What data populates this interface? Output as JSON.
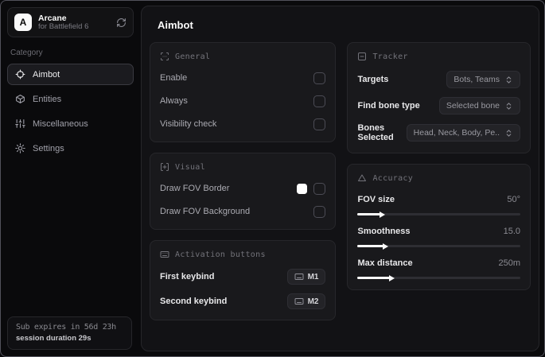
{
  "sidebar": {
    "logo_letter": "A",
    "app_name": "Arcane",
    "app_subtitle": "for Battlefield 6",
    "category_label": "Category",
    "items": [
      {
        "label": "Aimbot",
        "icon": "crosshair-icon",
        "active": true
      },
      {
        "label": "Entities",
        "icon": "cube-icon",
        "active": false
      },
      {
        "label": "Miscellaneous",
        "icon": "sliders-icon",
        "active": false
      },
      {
        "label": "Settings",
        "icon": "gear-icon",
        "active": false
      }
    ],
    "subscription": {
      "expires": "Sub expires in 56d 23h",
      "session": "session duration 29s"
    }
  },
  "main": {
    "title": "Aimbot",
    "general": {
      "title": "General",
      "rows": [
        {
          "label": "Enable",
          "checked": false
        },
        {
          "label": "Always",
          "checked": false
        },
        {
          "label": "Visibility check",
          "checked": false
        }
      ]
    },
    "visual": {
      "title": "Visual",
      "rows": [
        {
          "label": "Draw FOV Border",
          "swatch_color": "#ffffff",
          "checked": false
        },
        {
          "label": "Draw FOV Background",
          "checked": false
        }
      ]
    },
    "activation": {
      "title": "Activation buttons",
      "rows": [
        {
          "label": "First keybind",
          "key": "M1"
        },
        {
          "label": "Second keybind",
          "key": "M2"
        }
      ]
    },
    "tracker": {
      "title": "Tracker",
      "rows": [
        {
          "label": "Targets",
          "value": "Bots, Teams"
        },
        {
          "label": "Find bone type",
          "value": "Selected bone"
        },
        {
          "label": "Bones Selected",
          "value": "Head, Neck, Body, Pe.."
        }
      ]
    },
    "accuracy": {
      "title": "Accuracy",
      "sliders": [
        {
          "label": "FOV size",
          "value": "50°",
          "fill_pct": 14
        },
        {
          "label": "Smoothness",
          "value": "15.0",
          "fill_pct": 16
        },
        {
          "label": "Max distance",
          "value": "250m",
          "fill_pct": 20
        }
      ]
    }
  }
}
